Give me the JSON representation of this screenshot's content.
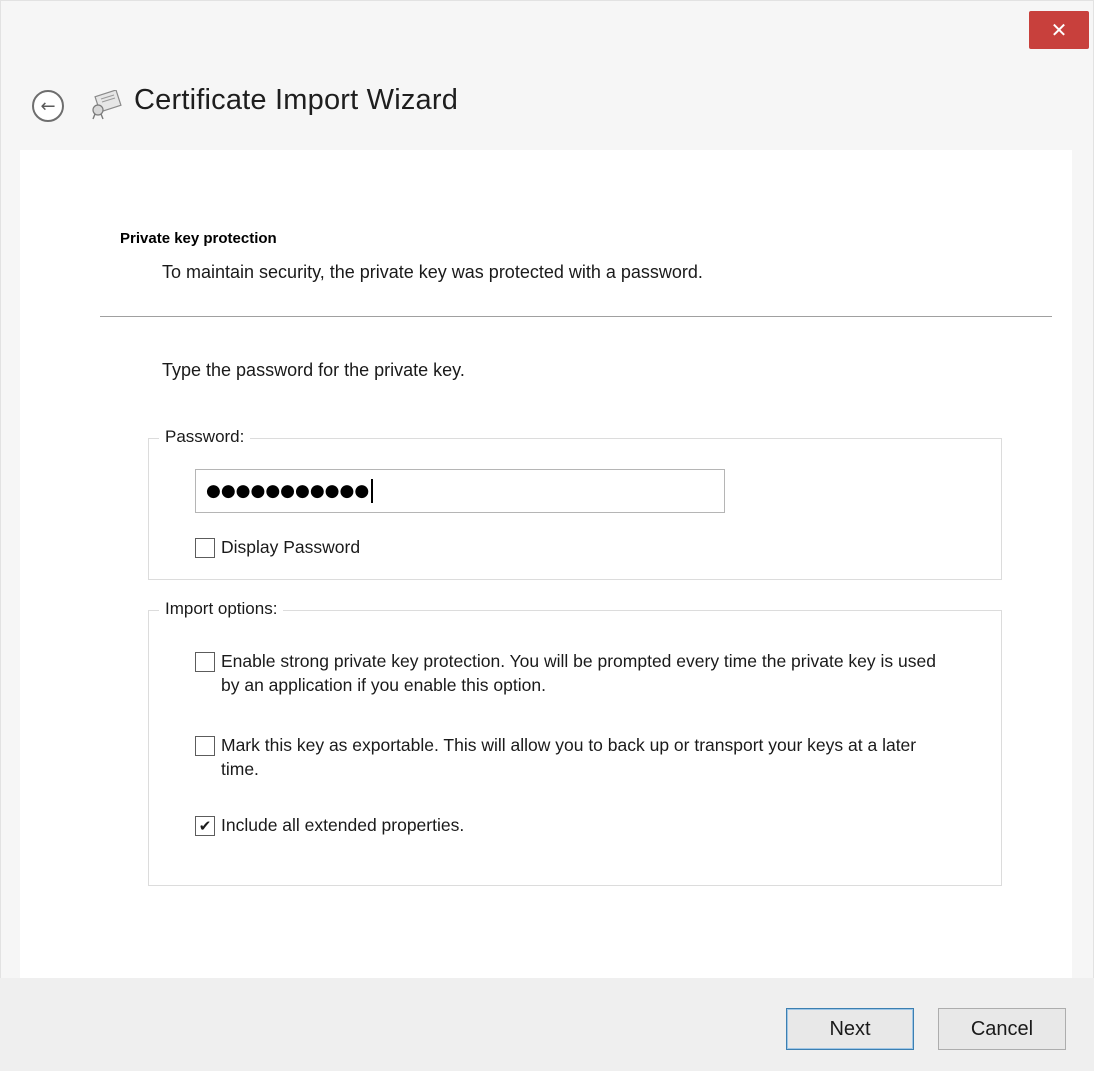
{
  "window": {
    "title": "Certificate Import Wizard",
    "close_glyph": "✕",
    "back_glyph": "←"
  },
  "page": {
    "heading": "Private key protection",
    "description": "To maintain security, the private key was protected with a password.",
    "instruction": "Type the password for the private key."
  },
  "password_group": {
    "legend": "Password:",
    "value": "●●●●●●●●●●●",
    "display_password": {
      "label": "Display Password",
      "checked": false
    }
  },
  "import_group": {
    "legend": "Import options:",
    "options": [
      {
        "label": "Enable strong private key protection. You will be prompted every time the private key is used by an application if you enable this option.",
        "checked": false,
        "mark": ""
      },
      {
        "label": "Mark this key as exportable. This will allow you to back up or transport your keys at a later time.",
        "checked": false,
        "mark": ""
      },
      {
        "label": "Include all extended properties.",
        "checked": true,
        "mark": "✔"
      }
    ]
  },
  "footer": {
    "next_label": "Next",
    "cancel_label": "Cancel"
  },
  "colors": {
    "close_button": "#c8403c",
    "default_button_border": "#3c7fb1"
  },
  "icons": {
    "back": "back-arrow-icon",
    "wizard": "certificate-icon",
    "close": "close-icon",
    "check": "checkmark-icon"
  }
}
